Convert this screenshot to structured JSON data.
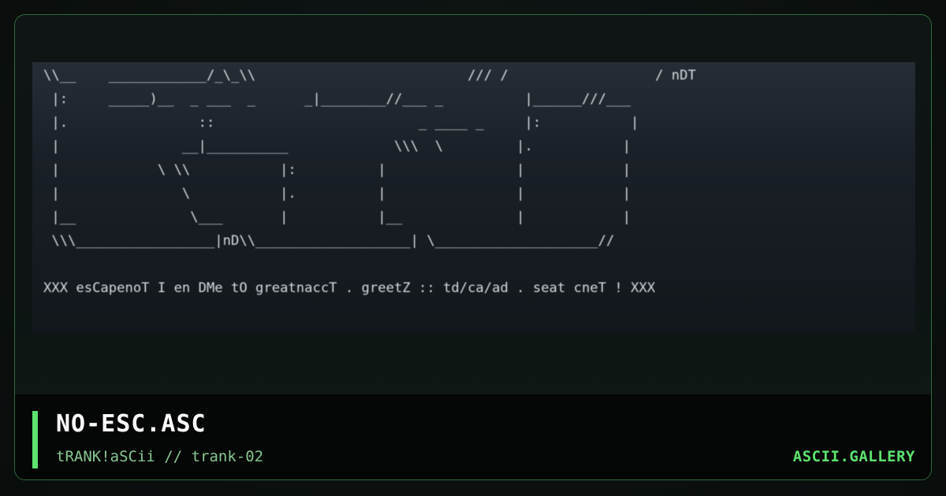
{
  "artwork": {
    "ascii_lines": [
      "\\\\__    ____________/_\\_\\\\                          /// /                  / nDT",
      " |:     _____)__  _ ___  _      _|________//___ _          |______///___",
      " |.                ::                         _ ____ _     |:           |",
      " |               __|__________             \\\\\\  \\         |.           |",
      " |            \\ \\\\           |:          |                |            |",
      " |               \\           |.          |                |            |",
      " |__              \\___       |           |__              |            |",
      " \\\\\\_________________|nD\\\\___________________| \\____________________//",
      "",
      "XXX esCapenoT I en DMe tO greatnaccT . greetZ :: td/ca/ad . seat cneT ! XXX"
    ]
  },
  "footer": {
    "title": "NO-ESC.ASC",
    "subtitle": "tRANK!aSCii // trank-02",
    "brand": "ASCII.GALLERY"
  },
  "colors": {
    "accent": "#5de36f",
    "subtitle": "#86c791",
    "border": "#2f6a3a",
    "art_text": "#d6dbe0"
  }
}
